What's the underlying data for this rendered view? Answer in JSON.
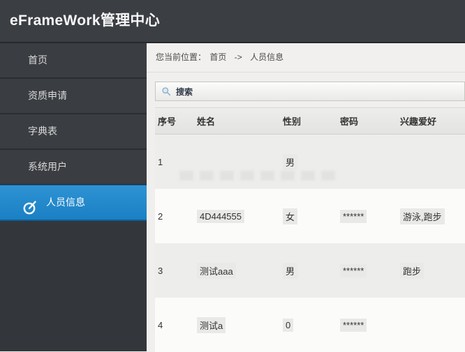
{
  "header": {
    "title": "eFrameWork管理中心"
  },
  "sidebar": {
    "items": [
      {
        "label": "首页",
        "active": false
      },
      {
        "label": "资质申请",
        "active": false
      },
      {
        "label": "字典表",
        "active": false
      },
      {
        "label": "系统用户",
        "active": false
      },
      {
        "label": "人员信息",
        "active": true,
        "icon": "gauge-icon"
      }
    ]
  },
  "breadcrumb": {
    "prefix": "您当前位置：",
    "items": [
      "首页",
      "人员信息"
    ],
    "separator": "->"
  },
  "search": {
    "label": "搜索",
    "icon": "magnifier-icon"
  },
  "table": {
    "columns": [
      "序号",
      "姓名",
      "性别",
      "密码",
      "兴趣爱好"
    ],
    "rows": [
      {
        "no": "1",
        "name": "",
        "gender": "男",
        "password": "",
        "hobby": ""
      },
      {
        "no": "2",
        "name": "4D444555",
        "gender": "女",
        "password": "******",
        "hobby": "游泳,跑步"
      },
      {
        "no": "3",
        "name": "测试aaa",
        "gender": "男",
        "password": "******",
        "hobby": "跑步"
      },
      {
        "no": "4",
        "name": "测试a",
        "gender": "0",
        "password": "******",
        "hobby": ""
      }
    ]
  },
  "colors": {
    "accent_blue": "#1f87cc",
    "header_bg": "#3b3e43",
    "sidebar_item_bg": "#3a3d41",
    "sidebar_separator": "#2b2e31",
    "row_alt_gray": "#ededeb",
    "row_white": "#fbfbfa",
    "grid_header_bg": "#e8e8e6"
  }
}
